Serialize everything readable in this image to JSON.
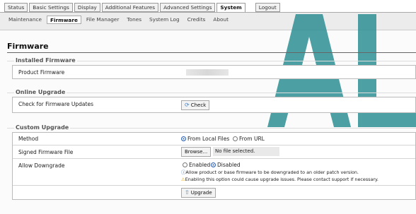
{
  "top_tabs": [
    {
      "label": "Status",
      "active": false
    },
    {
      "label": "Basic Settings",
      "active": false
    },
    {
      "label": "Display",
      "active": false
    },
    {
      "label": "Additional Features",
      "active": false
    },
    {
      "label": "Advanced Settings",
      "active": false
    },
    {
      "label": "System",
      "active": true
    },
    {
      "label": "Logout",
      "active": false
    }
  ],
  "sub_nav": [
    {
      "label": "Maintenance",
      "active": false
    },
    {
      "label": "Firmware",
      "active": true
    },
    {
      "label": "File Manager",
      "active": false
    },
    {
      "label": "Tones",
      "active": false
    },
    {
      "label": "System Log",
      "active": false
    },
    {
      "label": "Credits",
      "active": false
    },
    {
      "label": "About",
      "active": false
    }
  ],
  "watermark_text": "AL",
  "page_title": "Firmware",
  "installed": {
    "legend": "Installed Firmware",
    "product_label": "Product Firmware"
  },
  "online": {
    "legend": "Online Upgrade",
    "check_label": "Check for Firmware Updates",
    "check_button": "Check"
  },
  "custom": {
    "legend": "Custom Upgrade",
    "method_label": "Method",
    "method_options": [
      "From Local Files",
      "From URL"
    ],
    "method_selected": "From Local Files",
    "signed_label": "Signed Firmware File",
    "browse_button": "Browse...",
    "file_status": "No file selected.",
    "downgrade_label": "Allow Downgrade",
    "downgrade_options": [
      "Enabled",
      "Disabled"
    ],
    "downgrade_selected": "Disabled",
    "info_note": "Allow product or base firmware to be downgraded to an older patch version.",
    "warn_note": "Enabling this option could cause upgrade issues. Please contact support if necessary.",
    "upgrade_button": "Upgrade"
  },
  "colors": {
    "accent": "#2a63b8",
    "watermark": "#2e8f93"
  }
}
